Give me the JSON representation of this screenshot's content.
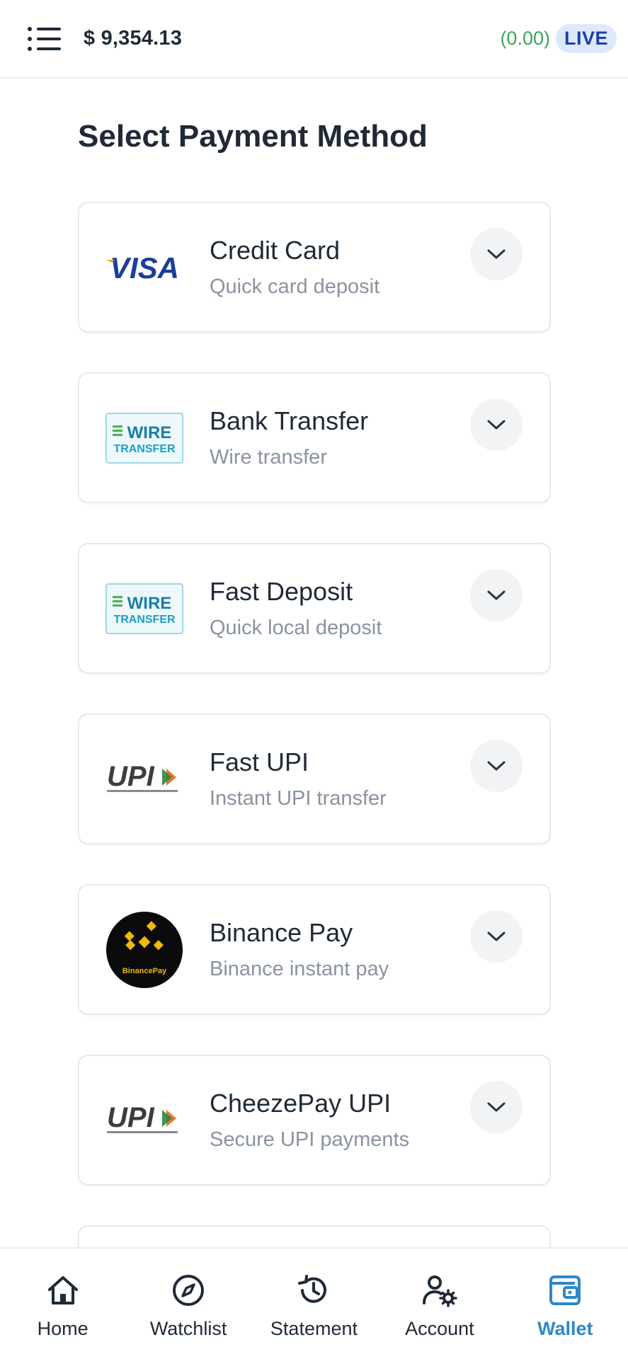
{
  "header": {
    "balance": "$ 9,354.13",
    "pnl": "(0.00)",
    "mode_badge": "LIVE",
    "menu_icon": "list-menu-icon"
  },
  "page": {
    "title": "Select Payment Method"
  },
  "methods": [
    {
      "name": "Credit Card",
      "desc": "Quick card deposit",
      "logo": "visa-logo",
      "logo_text": "VISA"
    },
    {
      "name": "Bank Transfer",
      "desc": "Wire transfer",
      "logo": "wire-transfer-logo",
      "logo_text": "WIRE TRANSFER"
    },
    {
      "name": "Fast Deposit",
      "desc": "Quick local deposit",
      "logo": "wire-transfer-logo",
      "logo_text": "WIRE TRANSFER"
    },
    {
      "name": "Fast UPI",
      "desc": "Instant UPI transfer",
      "logo": "upi-logo",
      "logo_text": "UPI"
    },
    {
      "name": "Binance Pay",
      "desc": "Binance instant pay",
      "logo": "binance-pay-logo",
      "logo_text": "BinancePay"
    },
    {
      "name": "CheezePay UPI",
      "desc": "Secure UPI payments",
      "logo": "upi-logo",
      "logo_text": "UPI"
    }
  ],
  "nav": [
    {
      "label": "Home",
      "icon": "home-icon"
    },
    {
      "label": "Watchlist",
      "icon": "compass-icon"
    },
    {
      "label": "Statement",
      "icon": "history-icon"
    },
    {
      "label": "Account",
      "icon": "user-gear-icon"
    },
    {
      "label": "Wallet",
      "icon": "wallet-icon",
      "active": true
    }
  ],
  "colors": {
    "accent": "#2f87c9",
    "positive": "#3aa55d",
    "badge_bg": "#dde9fb",
    "badge_text": "#1f3fa8"
  }
}
